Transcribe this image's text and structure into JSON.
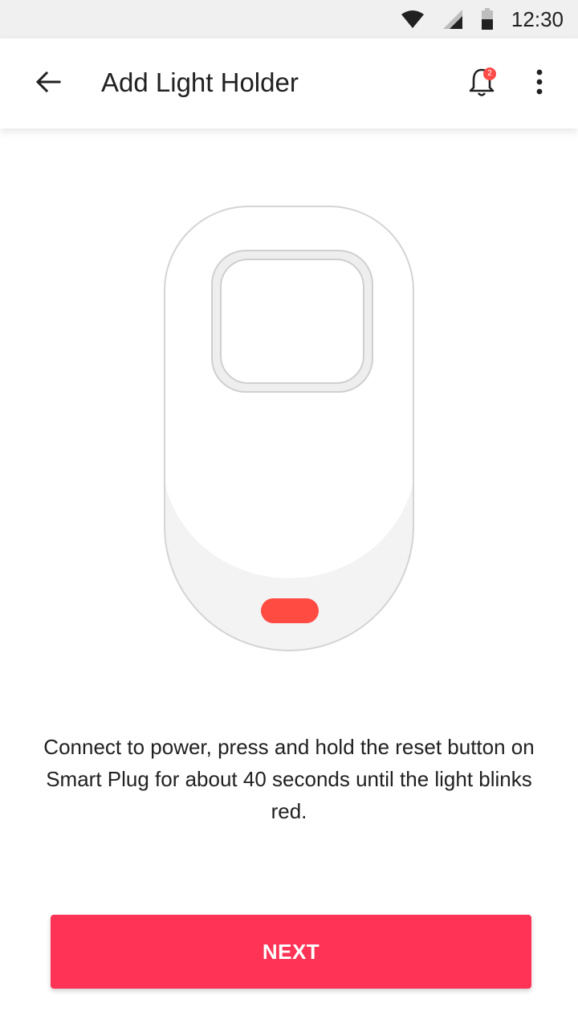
{
  "status_bar": {
    "time": "12:30",
    "icons": [
      "wifi-icon",
      "signal-icon",
      "battery-icon"
    ]
  },
  "header": {
    "title": "Add Light Holder",
    "notification_count": "2",
    "icons": [
      "back-arrow-icon",
      "bell-icon",
      "more-vert-icon"
    ]
  },
  "illustration": {
    "indicator_color": "#ff4b42"
  },
  "main": {
    "instruction": "Connect to power, press and hold the reset button on Smart Plug for about 40 seconds until the light blinks red."
  },
  "footer": {
    "next_label": "NEXT"
  },
  "colors": {
    "accent": "#ff3355",
    "badge": "#ff4b47"
  }
}
